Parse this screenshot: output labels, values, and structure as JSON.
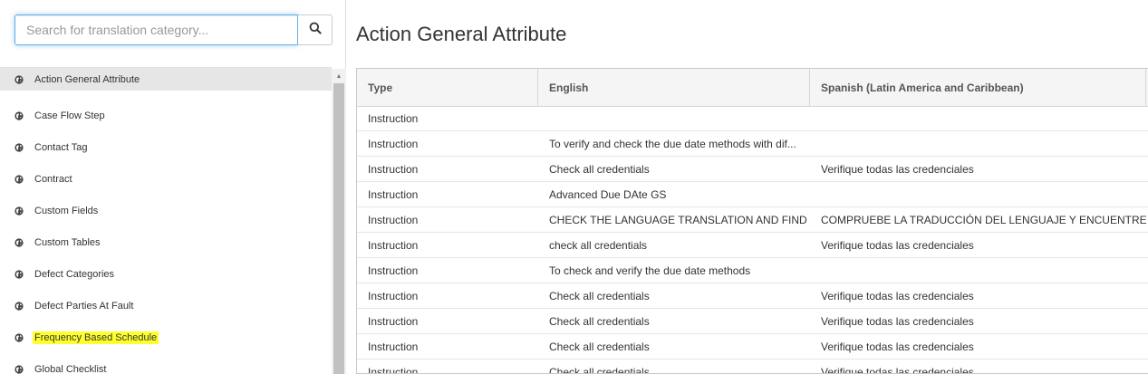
{
  "search": {
    "placeholder": "Search for translation category..."
  },
  "sidebar": {
    "items": [
      {
        "label": "Action General Attribute"
      },
      {
        "label": "Case Flow Step"
      },
      {
        "label": "Contact Tag"
      },
      {
        "label": "Contract"
      },
      {
        "label": "Custom Fields"
      },
      {
        "label": "Custom Tables"
      },
      {
        "label": "Defect Categories"
      },
      {
        "label": "Defect Parties At Fault"
      },
      {
        "label": "Frequency Based Schedule"
      },
      {
        "label": "Global Checklist"
      }
    ],
    "active_index": 0,
    "highlighted_index": 8,
    "highlight_color": "#ffff2e"
  },
  "main": {
    "title": "Action General Attribute",
    "columns": [
      "Type",
      "English",
      "Spanish (Latin America and Caribbean)"
    ],
    "rows": [
      [
        "Instruction",
        "",
        ""
      ],
      [
        "Instruction",
        "To verify and check the due date methods with dif...",
        ""
      ],
      [
        "Instruction",
        "Check all credentials",
        "Verifique todas las credenciales"
      ],
      [
        "Instruction",
        "Advanced Due DAte GS",
        ""
      ],
      [
        "Instruction",
        "CHECK THE LANGUAGE TRANSLATION AND FIND ...",
        "COMPRUEBE LA TRADUCCIÓN DEL LENGUAJE Y ENCUENTRE SI..."
      ],
      [
        "Instruction",
        "check all credentials",
        "Verifique todas las credenciales"
      ],
      [
        "Instruction",
        "To check and verify the due date methods",
        ""
      ],
      [
        "Instruction",
        "Check all credentials",
        "Verifique todas las credenciales"
      ],
      [
        "Instruction",
        "Check all credentials",
        "Verifique todas las credenciales"
      ],
      [
        "Instruction",
        "Check all credentials",
        "Verifique todas las credenciales"
      ],
      [
        "Instruction",
        "Check all credentials",
        "Verifique todas las credenciales"
      ]
    ]
  },
  "icons": {
    "search": "search-icon",
    "item": "globe-icon",
    "scroll": "scroll-up-arrow-icon"
  },
  "colors": {
    "focus_border": "#66afe9",
    "active_item": "#e6e6e6",
    "header_bg": "#f5f5f5"
  }
}
